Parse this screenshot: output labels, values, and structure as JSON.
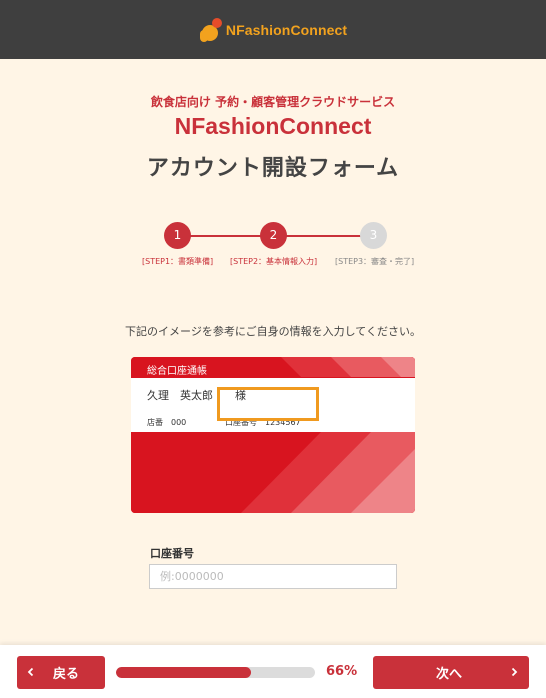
{
  "header": {
    "logo_text": "NFashionConnect"
  },
  "intro": {
    "subtitle": "飲食店向け 予約・顧客管理クラウドサービス",
    "brand": "NFashionConnect",
    "form_title": "アカウント開設フォーム"
  },
  "stepper": {
    "steps": [
      {
        "number": "1",
        "label": "[STEP1：書類準備]",
        "state": "done"
      },
      {
        "number": "2",
        "label": "[STEP2：基本情報入力]",
        "state": "current"
      },
      {
        "number": "3",
        "label": "[STEP3：審査・完了]",
        "state": "upcoming"
      }
    ]
  },
  "instruction": "下記のイメージを参考にご自身の情報を入力してください。",
  "passbook": {
    "header": "総合口座通帳",
    "name": "久理　英太郎　　様",
    "branch": "店番　000",
    "account": "口座番号　1234567"
  },
  "field": {
    "label": "口座番号",
    "placeholder": "例:0000000",
    "value": ""
  },
  "footer": {
    "back_label": "戻る",
    "next_label": "次へ",
    "progress_text": "66%",
    "progress_fraction": 0.68
  },
  "colors": {
    "accent": "#c9313a",
    "header_bg": "#3f3f3f",
    "page_bg": "#fff5e6",
    "highlight": "#f09a1f"
  },
  "icons": {
    "back": "chevron-left-icon",
    "next": "chevron-right-icon"
  }
}
